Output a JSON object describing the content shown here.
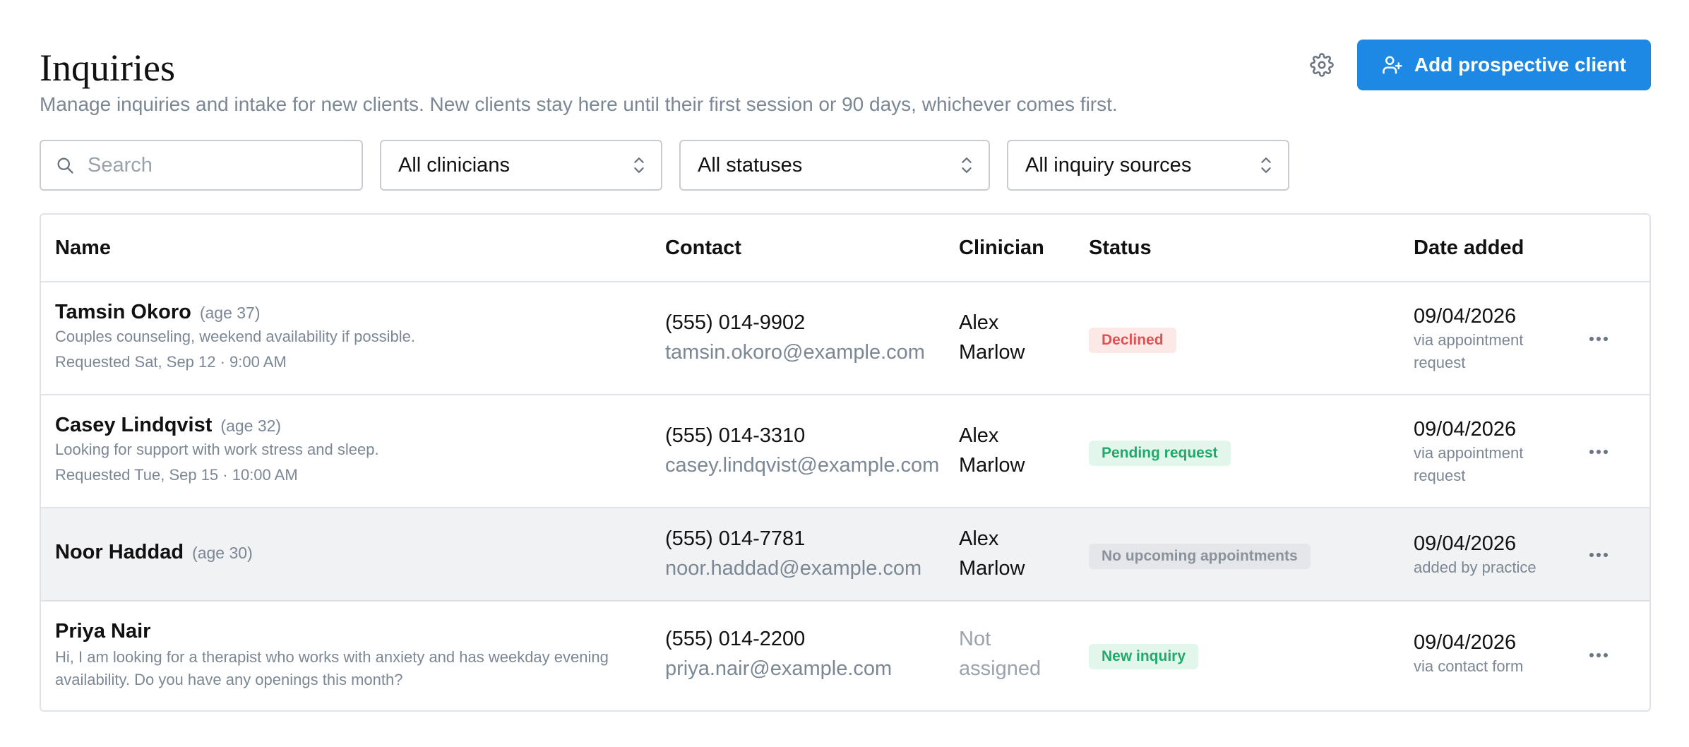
{
  "header": {
    "title": "Inquiries",
    "subtitle": "Manage inquiries and intake for new clients. New clients stay here until their first session or 90 days, whichever comes first.",
    "add_button_label": "Add prospective client"
  },
  "filters": {
    "search_placeholder": "Search",
    "clinician_select": "All clinicians",
    "status_select": "All statuses",
    "source_select": "All inquiry sources"
  },
  "table": {
    "columns": [
      "Name",
      "Contact",
      "Clinician",
      "Status",
      "Date added"
    ],
    "rows": [
      {
        "name": "Tamsin Okoro",
        "age": "(age 37)",
        "note1": "Couples counseling, weekend availability if possible.",
        "note2": "Requested Sat, Sep 12 · 9:00 AM",
        "phone": "(555) 014-9902",
        "email": "tamsin.okoro@example.com",
        "clinician": "Alex Marlow",
        "status": "Declined",
        "date": "09/04/2026",
        "source": "via appointment request"
      },
      {
        "name": "Casey Lindqvist",
        "age": "(age 32)",
        "note1": "Looking for support with work stress and sleep.",
        "note2": "Requested Tue, Sep 15 · 10:00 AM",
        "phone": "(555) 014-3310",
        "email": "casey.lindqvist@example.com",
        "clinician": "Alex Marlow",
        "status": "Pending request",
        "date": "09/04/2026",
        "source": "via appointment request"
      },
      {
        "name": "Noor Haddad",
        "age": "(age 30)",
        "phone": "(555) 014-7781",
        "email": "noor.haddad@example.com",
        "clinician": "Alex Marlow",
        "status": "No upcoming appointments",
        "date": "09/04/2026",
        "source": "added by practice"
      },
      {
        "name": "Priya Nair",
        "note1": "Hi, I am looking for a therapist who works with anxiety and has weekday evening availability. Do you have any openings this month?",
        "phone": "(555) 014-2200",
        "email": "priya.nair@example.com",
        "clinician": "Not assigned",
        "status": "New inquiry",
        "date": "09/04/2026",
        "source": "via contact form"
      }
    ]
  },
  "colors": {
    "accent": "#1e88e5",
    "declined": "#e05252",
    "pending": "#20a96a",
    "neutral": "#8a929c"
  },
  "icons": [
    "gear-icon",
    "add-user-icon",
    "search-icon",
    "chevron-updown-icon",
    "more-icon"
  ]
}
